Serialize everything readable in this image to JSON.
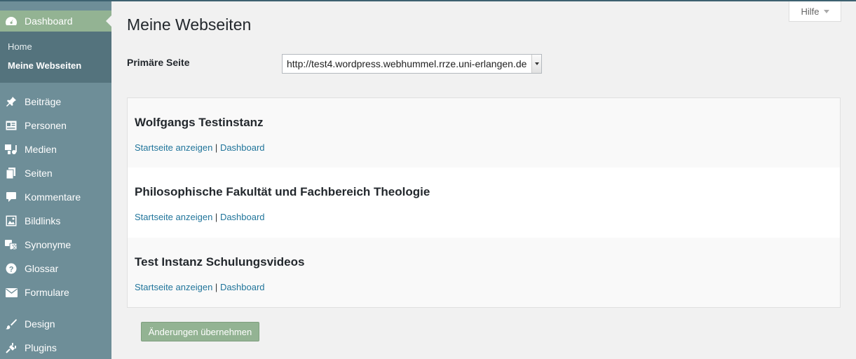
{
  "sidebar": {
    "dashboard_label": "Dashboard",
    "submenu": [
      {
        "label": "Home"
      },
      {
        "label": "Meine Webseiten"
      }
    ],
    "items": [
      {
        "label": "Beiträge",
        "icon": "pushpin-icon"
      },
      {
        "label": "Personen",
        "icon": "id-card-icon"
      },
      {
        "label": "Medien",
        "icon": "media-icon"
      },
      {
        "label": "Seiten",
        "icon": "pages-icon"
      },
      {
        "label": "Kommentare",
        "icon": "comment-icon"
      },
      {
        "label": "Bildlinks",
        "icon": "image-icon"
      },
      {
        "label": "Synonyme",
        "icon": "translate-icon"
      },
      {
        "label": "Glossar",
        "icon": "help-circle-icon"
      },
      {
        "label": "Formulare",
        "icon": "envelope-icon"
      },
      {
        "label": "Design",
        "icon": "brush-icon"
      },
      {
        "label": "Plugins",
        "icon": "plug-icon"
      }
    ]
  },
  "header": {
    "title": "Meine Webseiten",
    "help_label": "Hilfe"
  },
  "primary": {
    "label": "Primäre Seite",
    "selected_value": "http://test4.wordpress.webhummel.rrze.uni-erlangen.de"
  },
  "sites": [
    {
      "name": "Wolfgangs Testinstanz",
      "link_view": "Startseite anzeigen",
      "separator": "|",
      "link_dashboard": "Dashboard"
    },
    {
      "name": "Philosophische Fakultät und Fachbereich Theologie",
      "link_view": "Startseite anzeigen",
      "separator": "|",
      "link_dashboard": "Dashboard"
    },
    {
      "name": "Test Instanz Schulungsvideos",
      "link_view": "Startseite anzeigen",
      "separator": "|",
      "link_dashboard": "Dashboard"
    }
  ],
  "save_button_label": "Änderungen übernehmen",
  "colors": {
    "sidebar": "#6e8e98",
    "submenu": "#54737d",
    "accent": "#93b393",
    "link": "#21759b"
  }
}
